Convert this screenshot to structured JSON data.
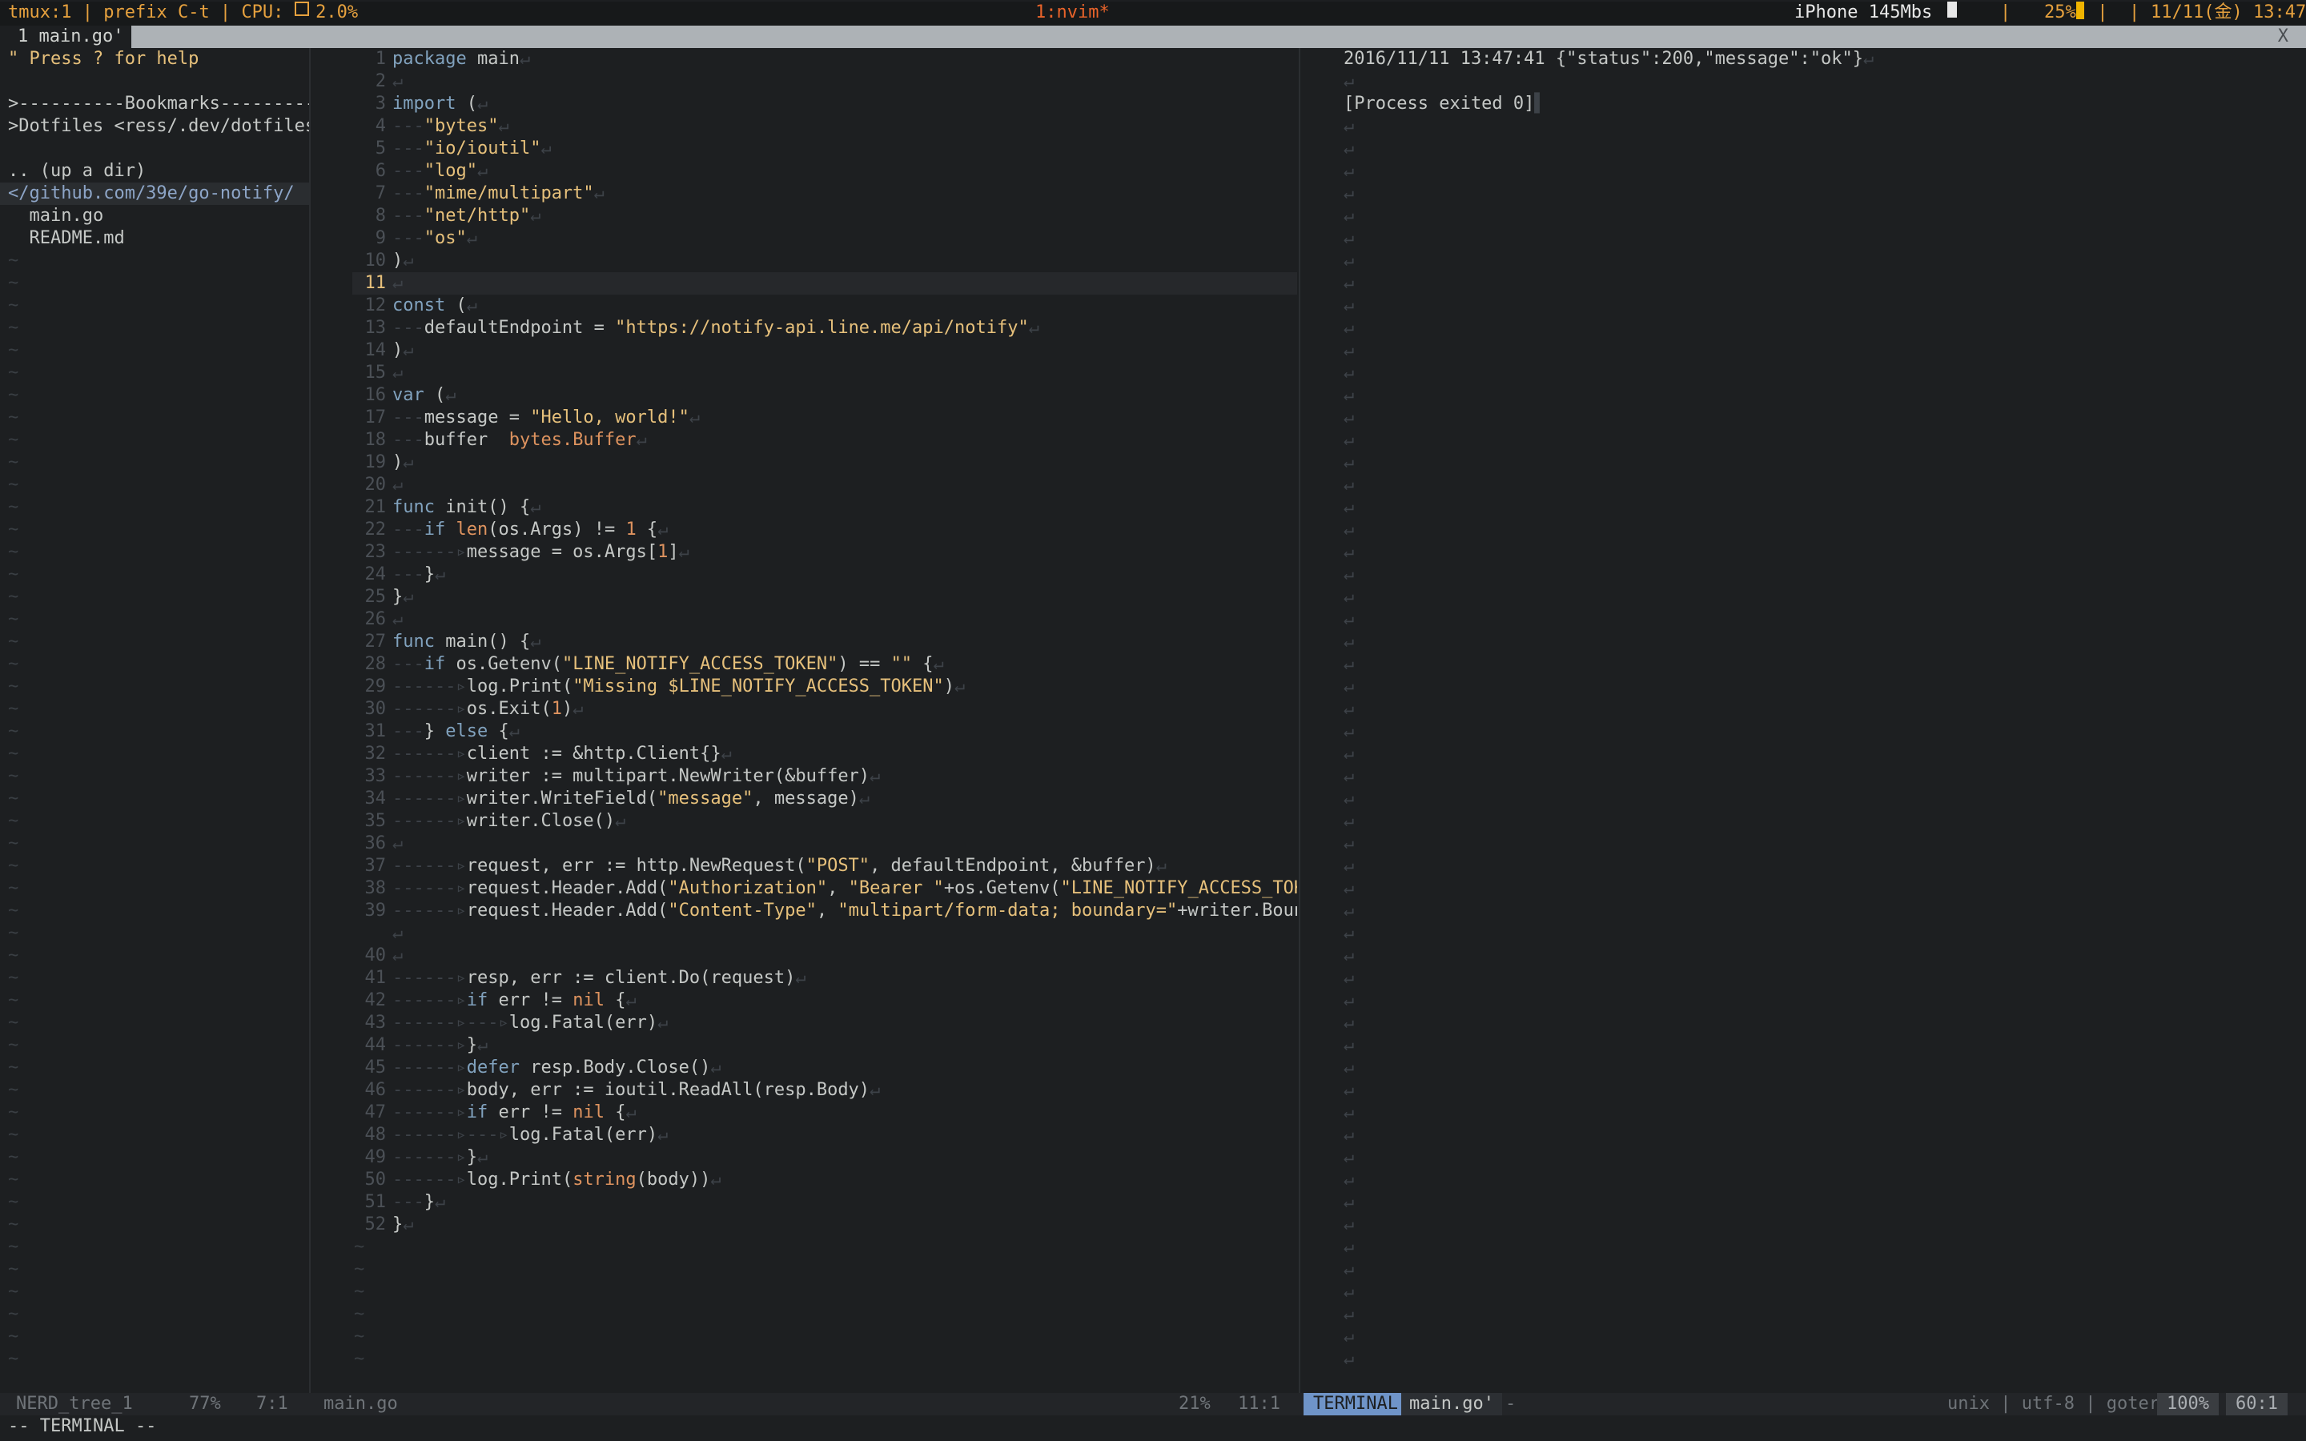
{
  "tmux": {
    "session": "tmux:1",
    "prefix": "prefix C-t",
    "cpu_label": "CPU:",
    "cpu_value": "2.0%",
    "window": "1:nvim*",
    "network": "iPhone 145Mbs",
    "battery": "25%",
    "datetime": "11/11(金) 13:47",
    "colors": {
      "accent": "#e6a13e",
      "window": "#e8632a"
    }
  },
  "tabline": {
    "tab": "1 main.go'",
    "close": "X"
  },
  "nerdtree": {
    "lines": [
      "\" Press ? for help",
      "",
      ">----------Bookmarks----------",
      ">Dotfiles <ress/.dev/dotfiles/",
      "",
      ".. (up a dir)",
      "</github.com/39e/go-notify/",
      "  main.go",
      "  README.md"
    ]
  },
  "editor": {
    "current_line": 11,
    "lines": [
      {
        "n": "1",
        "t": "package main"
      },
      {
        "n": "2",
        "t": ""
      },
      {
        "n": "3",
        "t": "import ("
      },
      {
        "n": "4",
        "t": "\"bytes\"",
        "indent": 1
      },
      {
        "n": "5",
        "t": "\"io/ioutil\"",
        "indent": 1
      },
      {
        "n": "6",
        "t": "\"log\"",
        "indent": 1
      },
      {
        "n": "7",
        "t": "\"mime/multipart\"",
        "indent": 1
      },
      {
        "n": "8",
        "t": "\"net/http\"",
        "indent": 1
      },
      {
        "n": "9",
        "t": "\"os\"",
        "indent": 1
      },
      {
        "n": "10",
        "t": ")"
      },
      {
        "n": "11",
        "t": ""
      },
      {
        "n": "12",
        "t": "const ("
      },
      {
        "n": "13",
        "t": "defaultEndpoint = \"https://notify-api.line.me/api/notify\"",
        "indent": 1
      },
      {
        "n": "14",
        "t": ")"
      },
      {
        "n": "15",
        "t": ""
      },
      {
        "n": "16",
        "t": "var ("
      },
      {
        "n": "17",
        "t": "message = \"Hello, world!\"",
        "indent": 1
      },
      {
        "n": "18",
        "t": "buffer  bytes.Buffer",
        "indent": 1
      },
      {
        "n": "19",
        "t": ")"
      },
      {
        "n": "20",
        "t": ""
      },
      {
        "n": "21",
        "t": "func init() {"
      },
      {
        "n": "22",
        "t": "if len(os.Args) != 1 {",
        "indent": 1
      },
      {
        "n": "23",
        "t": "message = os.Args[1]",
        "indent": 2
      },
      {
        "n": "24",
        "t": "}",
        "indent": 1
      },
      {
        "n": "25",
        "t": "}"
      },
      {
        "n": "26",
        "t": ""
      },
      {
        "n": "27",
        "t": "func main() {"
      },
      {
        "n": "28",
        "t": "if os.Getenv(\"LINE_NOTIFY_ACCESS_TOKEN\") == \"\" {",
        "indent": 1
      },
      {
        "n": "29",
        "t": "log.Print(\"Missing $LINE_NOTIFY_ACCESS_TOKEN\")",
        "indent": 2
      },
      {
        "n": "30",
        "t": "os.Exit(1)",
        "indent": 2
      },
      {
        "n": "31",
        "t": "} else {",
        "indent": 1
      },
      {
        "n": "32",
        "t": "client := &http.Client{}",
        "indent": 2
      },
      {
        "n": "33",
        "t": "writer := multipart.NewWriter(&buffer)",
        "indent": 2
      },
      {
        "n": "34",
        "t": "writer.WriteField(\"message\", message)",
        "indent": 2
      },
      {
        "n": "35",
        "t": "writer.Close()",
        "indent": 2
      },
      {
        "n": "36",
        "t": ""
      },
      {
        "n": "37",
        "t": "request, err := http.NewRequest(\"POST\", defaultEndpoint, &buffer)",
        "indent": 2
      },
      {
        "n": "38",
        "t": "request.Header.Add(\"Authorization\", \"Bearer \"+os.Getenv(\"LINE_NOTIFY_ACCESS_TOKEN\"))",
        "indent": 2
      },
      {
        "n": "39",
        "t": "request.Header.Add(\"Content-Type\", \"multipart/form-data; boundary=\"+writer.Boundary())",
        "indent": 2
      },
      {
        "n": "",
        "t": ""
      },
      {
        "n": "40",
        "t": ""
      },
      {
        "n": "41",
        "t": "resp, err := client.Do(request)",
        "indent": 2
      },
      {
        "n": "42",
        "t": "if err != nil {",
        "indent": 2
      },
      {
        "n": "43",
        "t": "log.Fatal(err)",
        "indent": 3
      },
      {
        "n": "44",
        "t": "}",
        "indent": 2
      },
      {
        "n": "45",
        "t": "defer resp.Body.Close()",
        "indent": 2
      },
      {
        "n": "46",
        "t": "body, err := ioutil.ReadAll(resp.Body)",
        "indent": 2
      },
      {
        "n": "47",
        "t": "if err != nil {",
        "indent": 2
      },
      {
        "n": "48",
        "t": "log.Fatal(err)",
        "indent": 3
      },
      {
        "n": "49",
        "t": "}",
        "indent": 2
      },
      {
        "n": "50",
        "t": "log.Print(string(body))",
        "indent": 2
      },
      {
        "n": "51",
        "t": "}",
        "indent": 1
      },
      {
        "n": "52",
        "t": "}"
      }
    ]
  },
  "terminal": {
    "lines": [
      "2016/11/11 13:47:41 {\"status\":200,\"message\":\"ok\"}",
      "",
      "[Process exited 0]"
    ]
  },
  "statusline": {
    "left_name": "NERD_tree_1",
    "left_pct": "77%",
    "left_pos": "7:1",
    "mid_file": "main.go",
    "mid_pct": "21%",
    "mid_pos": "11:1",
    "term_badge": "TERMINAL",
    "term_name": "main.go'",
    "term_dash": "-",
    "format": "unix",
    "encoding": "utf-8",
    "filetype": "goterm",
    "percent": "100%",
    "position": "60:1"
  },
  "mode": "-- TERMINAL --"
}
